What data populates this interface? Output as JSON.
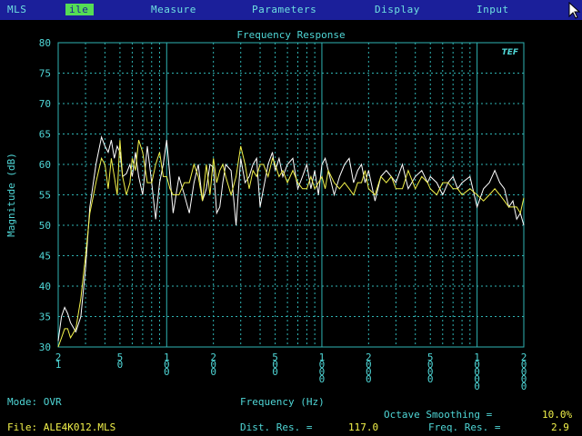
{
  "menu": {
    "items": [
      {
        "label": "MLS"
      },
      {
        "label": "ile",
        "active": true
      },
      {
        "label": "Measure"
      },
      {
        "label": "Parameters"
      },
      {
        "label": "Display"
      },
      {
        "label": "Input"
      }
    ]
  },
  "colors": {
    "menubar": "#1b1f9a",
    "active_menu": "#55dd55",
    "grid": "#2fb3b3",
    "text_cyan": "#4fd6d6",
    "trace_yellow": "#f2f24a",
    "trace_white": "#ffffff"
  },
  "chart_data": {
    "type": "line",
    "title": "Frequency Response",
    "logo": "TEF",
    "xlabel": "Frequency (Hz)",
    "ylabel": "Magnitude (dB)",
    "xscale": "log",
    "xlim": [
      20,
      20000
    ],
    "ylim": [
      30,
      80
    ],
    "grid": true,
    "yticks": [
      "30",
      "35",
      "40",
      "45",
      "50",
      "55",
      "60",
      "65",
      "70",
      "75",
      "80"
    ],
    "xticks": [
      {
        "value": 20,
        "label": "21"
      },
      {
        "value": 50,
        "label": "50"
      },
      {
        "value": 100,
        "label": "100"
      },
      {
        "value": 200,
        "label": "200"
      },
      {
        "value": 500,
        "label": "500"
      },
      {
        "value": 1000,
        "label": "1000"
      },
      {
        "value": 2000,
        "label": "2000"
      },
      {
        "value": 5000,
        "label": "5000"
      },
      {
        "value": 10000,
        "label": "10000"
      },
      {
        "value": 20000,
        "label": "20000"
      }
    ],
    "series": [
      {
        "color": "#ffffff",
        "x": [
          20,
          21,
          22,
          23,
          24,
          26,
          28,
          30,
          32,
          35,
          38,
          40,
          42,
          44,
          46,
          48,
          50,
          52,
          55,
          58,
          60,
          63,
          66,
          70,
          75,
          80,
          85,
          90,
          95,
          100,
          105,
          110,
          120,
          130,
          140,
          150,
          160,
          170,
          180,
          190,
          200,
          210,
          220,
          230,
          240,
          260,
          280,
          300,
          320,
          340,
          360,
          380,
          400,
          420,
          450,
          480,
          500,
          530,
          560,
          600,
          650,
          700,
          750,
          800,
          850,
          900,
          950,
          1000,
          1050,
          1100,
          1200,
          1300,
          1400,
          1500,
          1600,
          1700,
          1800,
          1900,
          2000,
          2200,
          2400,
          2600,
          2800,
          3000,
          3300,
          3600,
          4000,
          4400,
          4800,
          5000,
          5500,
          6000,
          6500,
          7000,
          7500,
          8000,
          9000,
          10000,
          11000,
          12000,
          13000,
          14000,
          15000,
          16000,
          17000,
          18000,
          19000,
          20000
        ],
        "y": [
          31,
          35,
          36.5,
          35.5,
          34,
          32.5,
          35,
          43,
          53,
          60,
          64.5,
          63,
          62,
          64,
          61,
          63,
          62,
          58,
          58.5,
          60,
          58,
          62,
          58,
          55,
          63,
          57,
          51,
          57,
          60,
          64,
          58,
          52,
          58,
          55,
          52,
          57,
          60,
          54,
          56,
          60,
          59.5,
          52,
          53,
          57,
          60,
          59,
          50,
          61,
          57,
          58,
          60,
          61,
          53,
          56,
          60,
          62,
          59,
          61,
          58,
          60,
          61,
          56,
          58,
          60,
          56,
          59,
          55,
          60,
          61,
          59,
          55,
          58,
          60,
          61,
          57,
          59,
          60,
          57,
          59,
          54,
          58,
          59,
          58,
          57,
          60,
          56,
          58,
          59,
          57,
          58,
          57,
          55,
          57,
          58,
          56,
          57,
          58,
          53,
          56,
          57,
          59,
          57,
          56,
          53,
          54,
          51,
          52,
          50
        ]
      },
      {
        "color": "#f2f24a",
        "x": [
          20,
          21,
          22,
          23,
          24,
          26,
          28,
          30,
          32,
          35,
          38,
          40,
          42,
          44,
          46,
          48,
          50,
          52,
          55,
          58,
          60,
          63,
          66,
          70,
          75,
          80,
          85,
          90,
          95,
          100,
          105,
          110,
          120,
          130,
          140,
          150,
          160,
          170,
          180,
          190,
          200,
          210,
          220,
          230,
          240,
          260,
          280,
          300,
          320,
          340,
          360,
          380,
          400,
          420,
          450,
          480,
          500,
          530,
          560,
          600,
          650,
          700,
          750,
          800,
          850,
          900,
          950,
          1000,
          1050,
          1100,
          1200,
          1300,
          1400,
          1500,
          1600,
          1700,
          1800,
          1900,
          2000,
          2200,
          2400,
          2600,
          2800,
          3000,
          3300,
          3600,
          4000,
          4400,
          4800,
          5000,
          5500,
          6000,
          6500,
          7000,
          7500,
          8000,
          9000,
          10000,
          11000,
          12000,
          13000,
          14000,
          15000,
          16000,
          17000,
          18000,
          19000,
          20000
        ],
        "y": [
          30,
          31.5,
          33,
          33,
          31.5,
          33,
          38,
          45,
          52,
          57,
          61,
          60,
          56,
          61,
          58,
          55,
          64,
          58,
          55,
          57,
          61,
          59,
          64,
          62,
          57,
          57,
          60,
          62,
          58,
          58,
          56,
          55,
          55,
          57,
          57,
          60,
          58,
          54,
          60,
          55,
          61,
          57,
          59,
          60,
          58,
          55,
          58,
          63,
          60,
          56,
          59,
          58,
          60,
          60,
          58,
          61,
          60,
          58,
          59,
          57,
          59,
          57,
          56,
          56,
          58,
          56,
          57,
          58,
          56,
          59,
          57,
          56,
          57,
          56,
          55,
          57,
          57,
          59,
          56,
          55,
          58,
          57,
          58,
          56,
          56,
          59,
          56,
          58,
          57,
          56,
          55,
          57,
          57,
          56,
          56,
          55,
          56,
          55,
          54,
          55,
          56,
          55,
          54,
          53,
          53,
          53,
          52,
          54.5
        ]
      }
    ]
  },
  "status": {
    "mode_label": "Mode: OVR",
    "file_label": "File: ALE4K012.MLS",
    "octave_label": "Octave Smoothing =",
    "octave_value": "10.0%",
    "dist_label": "Dist. Res. =",
    "dist_value": "117.0",
    "freq_label": "Freq. Res. =",
    "freq_value": "2.9"
  }
}
